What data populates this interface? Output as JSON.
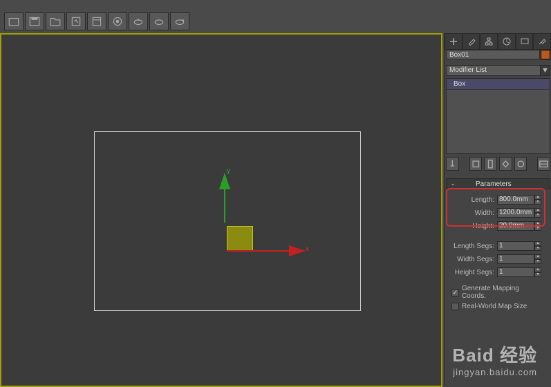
{
  "toolbar": {
    "icons": [
      "folder",
      "save",
      "save-all",
      "layers",
      "image",
      "render",
      "teapot",
      "teapot2",
      "teapot3"
    ]
  },
  "viewport": {
    "axis_x_label": "x",
    "axis_y_label": "y"
  },
  "panel": {
    "object_name": "Box01",
    "modifier_list_label": "Modifier List",
    "modifier_stack": {
      "item": "Box"
    }
  },
  "parameters": {
    "rollout_title": "Parameters",
    "toggle": "-",
    "length": {
      "label": "Length:",
      "value": "800.0mm"
    },
    "width": {
      "label": "Width:",
      "value": "1200.0mm"
    },
    "height": {
      "label": "Height:",
      "value": "20.0mm"
    },
    "length_segs": {
      "label": "Length Segs:",
      "value": "1"
    },
    "width_segs": {
      "label": "Width Segs:",
      "value": "1"
    },
    "height_segs": {
      "label": "Height Segs:",
      "value": "1"
    },
    "gen_mapping": {
      "label": "Generate Mapping Coords.",
      "checked": true
    },
    "real_world": {
      "label": "Real-World Map Size",
      "checked": false
    }
  },
  "watermark": {
    "main": "Baid 经验",
    "sub": "jingyan.baidu.com"
  }
}
